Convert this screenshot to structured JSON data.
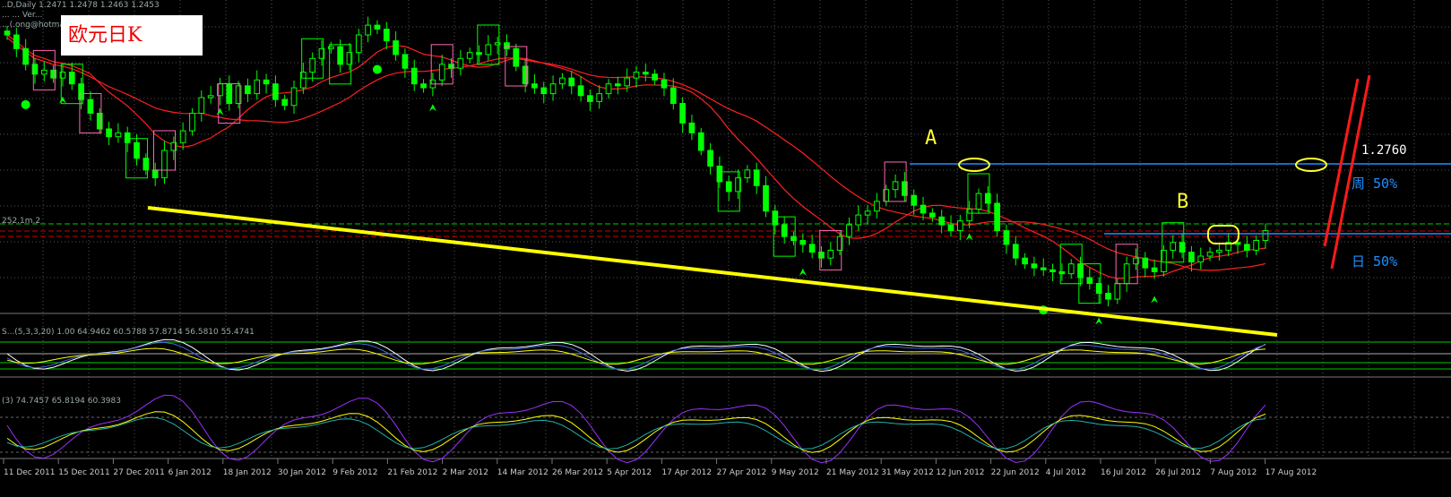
{
  "header": {
    "symbol_line": "..D,Daily  1.2471 1.2478 1.2463 1.2453",
    "line2": "...  ...  Ver...",
    "line3": "...(.ong@hotma..."
  },
  "title": "欧元日K",
  "annotations": {
    "label_a": "A",
    "label_b": "B",
    "price_label": "1.2760",
    "weekly_label": "周 50%",
    "daily_label": "日 50%",
    "hline_label": "252.1m.2"
  },
  "sub1_header": "S...(5,3,3,20) 1.00  64.9462 60.5788 57.8714 56.5810 55.4741",
  "sub2_header": "(3) 74.7457 65.8194 60.3983",
  "colors": {
    "bull": "#00ff00",
    "bear": "#00ff00",
    "ma": "#ff2020",
    "trend": "#ffff00",
    "level_line": "#1e90ff",
    "grid": "#555555"
  },
  "chart_data": [
    {
      "type": "candlestick",
      "title": "欧元日K",
      "x_ticks": [
        "11 Dec 2011",
        "15 Dec 2011",
        "27 Dec 2011",
        "6 Jan 2012",
        "18 Jan 2012",
        "30 Jan 2012",
        "9 Feb 2012",
        "21 Feb 2012",
        "2 Mar 2012",
        "14 Mar 2012",
        "26 Mar 2012",
        "5 Apr 2012",
        "17 Apr 2012",
        "27 Apr 2012",
        "9 May 2012",
        "21 May 2012",
        "31 May 2012",
        "12 Jun 2012",
        "22 Jun 2012",
        "4 Jul 2012",
        "16 Jul 2012",
        "26 Jul 2012",
        "7 Aug 2012",
        "17 Aug 2012"
      ],
      "price_levels": {
        "weekly_50": 1.276
      },
      "close_series": [
        1.345,
        1.338,
        1.33,
        1.325,
        1.327,
        1.323,
        1.326,
        1.32,
        1.312,
        1.305,
        1.297,
        1.293,
        1.295,
        1.29,
        1.282,
        1.276,
        1.272,
        1.286,
        1.29,
        1.296,
        1.305,
        1.313,
        1.314,
        1.32,
        1.31,
        1.319,
        1.315,
        1.322,
        1.32,
        1.312,
        1.309,
        1.318,
        1.326,
        1.333,
        1.338,
        1.339,
        1.33,
        1.336,
        1.345,
        1.35,
        1.348,
        1.342,
        1.335,
        1.328,
        1.32,
        1.318,
        1.322,
        1.33,
        1.328,
        1.333,
        1.336,
        1.335,
        1.34,
        1.341,
        1.338,
        1.329,
        1.32,
        1.318,
        1.315,
        1.32,
        1.323,
        1.319,
        1.314,
        1.311,
        1.315,
        1.32,
        1.319,
        1.323,
        1.326,
        1.325,
        1.322,
        1.318,
        1.31,
        1.3,
        1.295,
        1.286,
        1.278,
        1.27,
        1.265,
        1.272,
        1.276,
        1.268,
        1.255,
        1.248,
        1.242,
        1.24,
        1.238,
        1.234,
        1.231,
        1.235,
        1.242,
        1.248,
        1.253,
        1.255,
        1.26,
        1.266,
        1.27,
        1.263,
        1.258,
        1.254,
        1.252,
        1.248,
        1.245,
        1.25,
        1.256,
        1.264,
        1.259,
        1.245,
        1.238,
        1.231,
        1.228,
        1.226,
        1.225,
        1.224,
        1.223,
        1.228,
        1.221,
        1.218,
        1.213,
        1.21,
        1.218,
        1.228,
        1.231,
        1.226,
        1.224,
        1.235,
        1.239,
        1.234,
        1.229,
        1.232,
        1.234,
        1.235,
        1.239,
        1.238,
        1.235,
        1.24,
        1.245
      ]
    },
    {
      "type": "line",
      "title": "",
      "ylim": [
        0,
        100
      ],
      "levels": [
        20,
        50,
        80
      ]
    },
    {
      "type": "line",
      "title": "",
      "ylim": [
        0,
        100
      ],
      "levels": [
        20,
        50,
        80
      ]
    }
  ]
}
